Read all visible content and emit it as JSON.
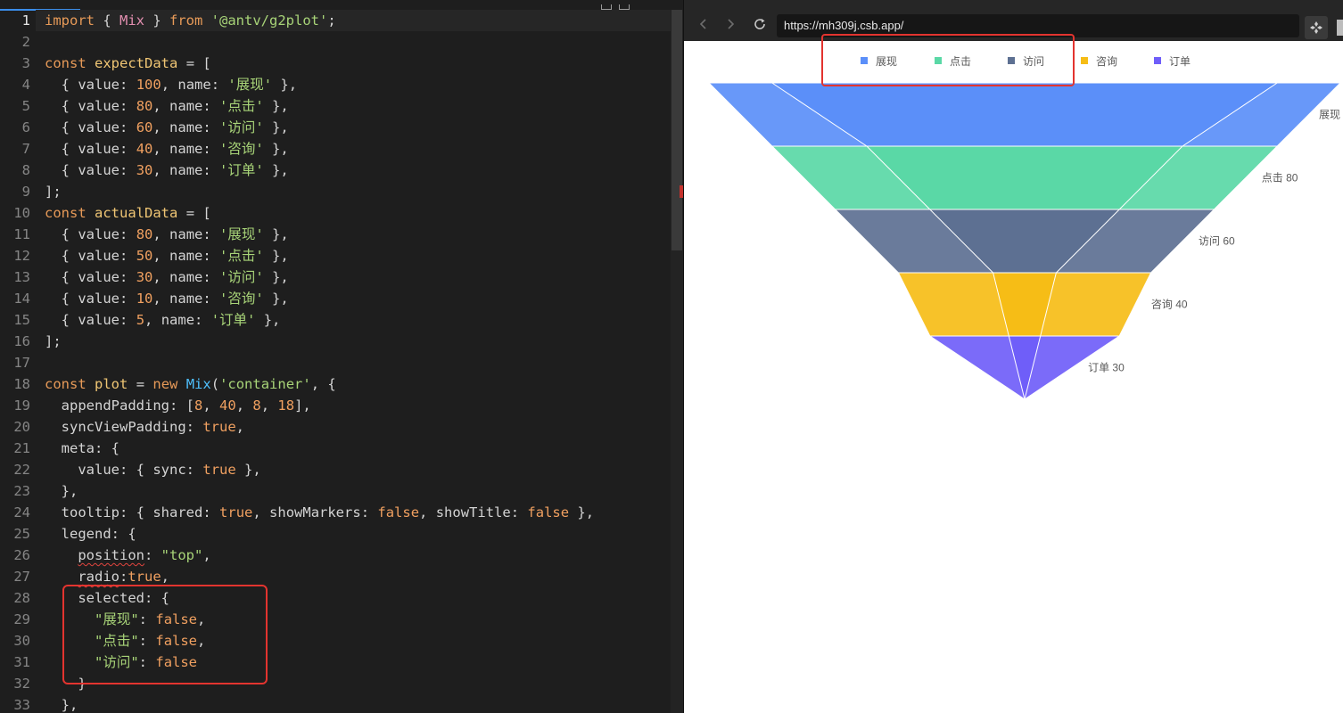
{
  "editor": {
    "current_line": 1,
    "lines": [
      {
        "n": "1",
        "t": [
          [
            "k",
            "import"
          ],
          [
            "p",
            " { "
          ],
          [
            "c",
            "Mix"
          ],
          [
            "p",
            " } "
          ],
          [
            "k",
            "from"
          ],
          [
            "p",
            " "
          ],
          [
            "s",
            "'@antv/g2plot'"
          ],
          [
            "p",
            ";"
          ]
        ]
      },
      {
        "n": "2",
        "t": []
      },
      {
        "n": "3",
        "t": [
          [
            "k",
            "const"
          ],
          [
            "p",
            " "
          ],
          [
            "v",
            "expectData"
          ],
          [
            "p",
            " "
          ],
          [
            "o",
            "="
          ],
          [
            "p",
            " ["
          ]
        ]
      },
      {
        "n": "4",
        "t": [
          [
            "p",
            "  { "
          ],
          [
            "t",
            "value"
          ],
          [
            "o",
            ":"
          ],
          [
            "p",
            " "
          ],
          [
            "n",
            "100"
          ],
          [
            "p",
            ", "
          ],
          [
            "t",
            "name"
          ],
          [
            "o",
            ":"
          ],
          [
            "p",
            " "
          ],
          [
            "s",
            "'展现'"
          ],
          [
            "p",
            " },"
          ]
        ]
      },
      {
        "n": "5",
        "t": [
          [
            "p",
            "  { "
          ],
          [
            "t",
            "value"
          ],
          [
            "o",
            ":"
          ],
          [
            "p",
            " "
          ],
          [
            "n",
            "80"
          ],
          [
            "p",
            ", "
          ],
          [
            "t",
            "name"
          ],
          [
            "o",
            ":"
          ],
          [
            "p",
            " "
          ],
          [
            "s",
            "'点击'"
          ],
          [
            "p",
            " },"
          ]
        ]
      },
      {
        "n": "6",
        "t": [
          [
            "p",
            "  { "
          ],
          [
            "t",
            "value"
          ],
          [
            "o",
            ":"
          ],
          [
            "p",
            " "
          ],
          [
            "n",
            "60"
          ],
          [
            "p",
            ", "
          ],
          [
            "t",
            "name"
          ],
          [
            "o",
            ":"
          ],
          [
            "p",
            " "
          ],
          [
            "s",
            "'访问'"
          ],
          [
            "p",
            " },"
          ]
        ]
      },
      {
        "n": "7",
        "t": [
          [
            "p",
            "  { "
          ],
          [
            "t",
            "value"
          ],
          [
            "o",
            ":"
          ],
          [
            "p",
            " "
          ],
          [
            "n",
            "40"
          ],
          [
            "p",
            ", "
          ],
          [
            "t",
            "name"
          ],
          [
            "o",
            ":"
          ],
          [
            "p",
            " "
          ],
          [
            "s",
            "'咨询'"
          ],
          [
            "p",
            " },"
          ]
        ]
      },
      {
        "n": "8",
        "t": [
          [
            "p",
            "  { "
          ],
          [
            "t",
            "value"
          ],
          [
            "o",
            ":"
          ],
          [
            "p",
            " "
          ],
          [
            "n",
            "30"
          ],
          [
            "p",
            ", "
          ],
          [
            "t",
            "name"
          ],
          [
            "o",
            ":"
          ],
          [
            "p",
            " "
          ],
          [
            "s",
            "'订单'"
          ],
          [
            "p",
            " },"
          ]
        ]
      },
      {
        "n": "9",
        "t": [
          [
            "p",
            "];"
          ]
        ]
      },
      {
        "n": "10",
        "t": [
          [
            "k",
            "const"
          ],
          [
            "p",
            " "
          ],
          [
            "v",
            "actualData"
          ],
          [
            "p",
            " "
          ],
          [
            "o",
            "="
          ],
          [
            "p",
            " ["
          ]
        ]
      },
      {
        "n": "11",
        "t": [
          [
            "p",
            "  { "
          ],
          [
            "t",
            "value"
          ],
          [
            "o",
            ":"
          ],
          [
            "p",
            " "
          ],
          [
            "n",
            "80"
          ],
          [
            "p",
            ", "
          ],
          [
            "t",
            "name"
          ],
          [
            "o",
            ":"
          ],
          [
            "p",
            " "
          ],
          [
            "s",
            "'展现'"
          ],
          [
            "p",
            " },"
          ]
        ]
      },
      {
        "n": "12",
        "t": [
          [
            "p",
            "  { "
          ],
          [
            "t",
            "value"
          ],
          [
            "o",
            ":"
          ],
          [
            "p",
            " "
          ],
          [
            "n",
            "50"
          ],
          [
            "p",
            ", "
          ],
          [
            "t",
            "name"
          ],
          [
            "o",
            ":"
          ],
          [
            "p",
            " "
          ],
          [
            "s",
            "'点击'"
          ],
          [
            "p",
            " },"
          ]
        ]
      },
      {
        "n": "13",
        "t": [
          [
            "p",
            "  { "
          ],
          [
            "t",
            "value"
          ],
          [
            "o",
            ":"
          ],
          [
            "p",
            " "
          ],
          [
            "n",
            "30"
          ],
          [
            "p",
            ", "
          ],
          [
            "t",
            "name"
          ],
          [
            "o",
            ":"
          ],
          [
            "p",
            " "
          ],
          [
            "s",
            "'访问'"
          ],
          [
            "p",
            " },"
          ]
        ]
      },
      {
        "n": "14",
        "t": [
          [
            "p",
            "  { "
          ],
          [
            "t",
            "value"
          ],
          [
            "o",
            ":"
          ],
          [
            "p",
            " "
          ],
          [
            "n",
            "10"
          ],
          [
            "p",
            ", "
          ],
          [
            "t",
            "name"
          ],
          [
            "o",
            ":"
          ],
          [
            "p",
            " "
          ],
          [
            "s",
            "'咨询'"
          ],
          [
            "p",
            " },"
          ]
        ]
      },
      {
        "n": "15",
        "t": [
          [
            "p",
            "  { "
          ],
          [
            "t",
            "value"
          ],
          [
            "o",
            ":"
          ],
          [
            "p",
            " "
          ],
          [
            "n",
            "5"
          ],
          [
            "p",
            ", "
          ],
          [
            "t",
            "name"
          ],
          [
            "o",
            ":"
          ],
          [
            "p",
            " "
          ],
          [
            "s",
            "'订单'"
          ],
          [
            "p",
            " },"
          ]
        ]
      },
      {
        "n": "16",
        "t": [
          [
            "p",
            "];"
          ]
        ]
      },
      {
        "n": "17",
        "t": []
      },
      {
        "n": "18",
        "t": [
          [
            "k",
            "const"
          ],
          [
            "p",
            " "
          ],
          [
            "v",
            "plot"
          ],
          [
            "p",
            " "
          ],
          [
            "o",
            "="
          ],
          [
            "p",
            " "
          ],
          [
            "k",
            "new"
          ],
          [
            "p",
            " "
          ],
          [
            "f",
            "Mix"
          ],
          [
            "p",
            "("
          ],
          [
            "s",
            "'container'"
          ],
          [
            "p",
            ", {"
          ]
        ]
      },
      {
        "n": "19",
        "t": [
          [
            "p",
            "  "
          ],
          [
            "t",
            "appendPadding"
          ],
          [
            "o",
            ":"
          ],
          [
            "p",
            " ["
          ],
          [
            "n",
            "8"
          ],
          [
            "p",
            ", "
          ],
          [
            "n",
            "40"
          ],
          [
            "p",
            ", "
          ],
          [
            "n",
            "8"
          ],
          [
            "p",
            ", "
          ],
          [
            "n",
            "18"
          ],
          [
            "p",
            "],"
          ]
        ]
      },
      {
        "n": "20",
        "t": [
          [
            "p",
            "  "
          ],
          [
            "t",
            "syncViewPadding"
          ],
          [
            "o",
            ":"
          ],
          [
            "p",
            " "
          ],
          [
            "b",
            "true"
          ],
          [
            "p",
            ","
          ]
        ]
      },
      {
        "n": "21",
        "t": [
          [
            "p",
            "  "
          ],
          [
            "t",
            "meta"
          ],
          [
            "o",
            ":"
          ],
          [
            "p",
            " {"
          ]
        ]
      },
      {
        "n": "22",
        "t": [
          [
            "p",
            "    "
          ],
          [
            "t",
            "value"
          ],
          [
            "o",
            ":"
          ],
          [
            "p",
            " { "
          ],
          [
            "t",
            "sync"
          ],
          [
            "o",
            ":"
          ],
          [
            "p",
            " "
          ],
          [
            "b",
            "true"
          ],
          [
            "p",
            " },"
          ]
        ]
      },
      {
        "n": "23",
        "t": [
          [
            "p",
            "  },"
          ]
        ]
      },
      {
        "n": "24",
        "t": [
          [
            "p",
            "  "
          ],
          [
            "t",
            "tooltip"
          ],
          [
            "o",
            ":"
          ],
          [
            "p",
            " { "
          ],
          [
            "t",
            "shared"
          ],
          [
            "o",
            ":"
          ],
          [
            "p",
            " "
          ],
          [
            "b",
            "true"
          ],
          [
            "p",
            ", "
          ],
          [
            "t",
            "showMarkers"
          ],
          [
            "o",
            ":"
          ],
          [
            "p",
            " "
          ],
          [
            "b",
            "false"
          ],
          [
            "p",
            ", "
          ],
          [
            "t",
            "showTitle"
          ],
          [
            "o",
            ":"
          ],
          [
            "p",
            " "
          ],
          [
            "b",
            "false"
          ],
          [
            "p",
            " },"
          ]
        ]
      },
      {
        "n": "25",
        "t": [
          [
            "p",
            "  "
          ],
          [
            "t",
            "legend"
          ],
          [
            "o",
            ":"
          ],
          [
            "p",
            " {"
          ]
        ]
      },
      {
        "n": "26",
        "t": [
          [
            "p",
            "    "
          ],
          [
            "squig",
            "position"
          ],
          [
            "o",
            ":"
          ],
          [
            "p",
            " "
          ],
          [
            "s",
            "\"top\""
          ],
          [
            "p",
            ","
          ]
        ]
      },
      {
        "n": "27",
        "t": [
          [
            "p",
            "    "
          ],
          [
            "squig",
            "radio"
          ],
          [
            "o",
            ":"
          ],
          [
            "b",
            "true"
          ],
          [
            "p",
            ","
          ]
        ]
      },
      {
        "n": "28",
        "t": [
          [
            "p",
            "    "
          ],
          [
            "t",
            "selected"
          ],
          [
            "o",
            ":"
          ],
          [
            "p",
            " {"
          ]
        ]
      },
      {
        "n": "29",
        "t": [
          [
            "p",
            "      "
          ],
          [
            "s",
            "\"展现\""
          ],
          [
            "o",
            ":"
          ],
          [
            "p",
            " "
          ],
          [
            "b",
            "false"
          ],
          [
            "p",
            ","
          ]
        ]
      },
      {
        "n": "30",
        "t": [
          [
            "p",
            "      "
          ],
          [
            "s",
            "\"点击\""
          ],
          [
            "o",
            ":"
          ],
          [
            "p",
            " "
          ],
          [
            "b",
            "false"
          ],
          [
            "p",
            ","
          ]
        ]
      },
      {
        "n": "31",
        "t": [
          [
            "p",
            "      "
          ],
          [
            "s",
            "\"访问\""
          ],
          [
            "o",
            ":"
          ],
          [
            "p",
            " "
          ],
          [
            "b",
            "false"
          ]
        ]
      },
      {
        "n": "32",
        "t": [
          [
            "p",
            "    }"
          ]
        ]
      },
      {
        "n": "33",
        "t": [
          [
            "p",
            "  },"
          ]
        ]
      }
    ]
  },
  "browser": {
    "url": "https://mh309j.csb.app/",
    "back_icon": "chevron-left-icon",
    "forward_icon": "chevron-right-icon",
    "reload_icon": "reload-icon",
    "extension_icon": "puzzle-icon"
  },
  "chart_data": {
    "type": "funnel",
    "legend_position": "top",
    "legend": [
      {
        "name": "展现",
        "color": "#5B8FF9"
      },
      {
        "name": "点击",
        "color": "#5AD8A6"
      },
      {
        "name": "访问",
        "color": "#5D7092"
      },
      {
        "name": "咨询",
        "color": "#F6BD16"
      },
      {
        "name": "订单",
        "color": "#6F5EF9"
      }
    ],
    "series": [
      {
        "values": [
          100,
          80,
          60,
          40,
          30
        ]
      },
      {
        "values": [
          80,
          50,
          30,
          10,
          5
        ]
      }
    ],
    "categories": [
      "展现",
      "点击",
      "访问",
      "咨询",
      "订单"
    ],
    "labels": [
      "展现",
      "点击 80",
      "访问 60",
      "咨询 40",
      "订单 30"
    ]
  }
}
